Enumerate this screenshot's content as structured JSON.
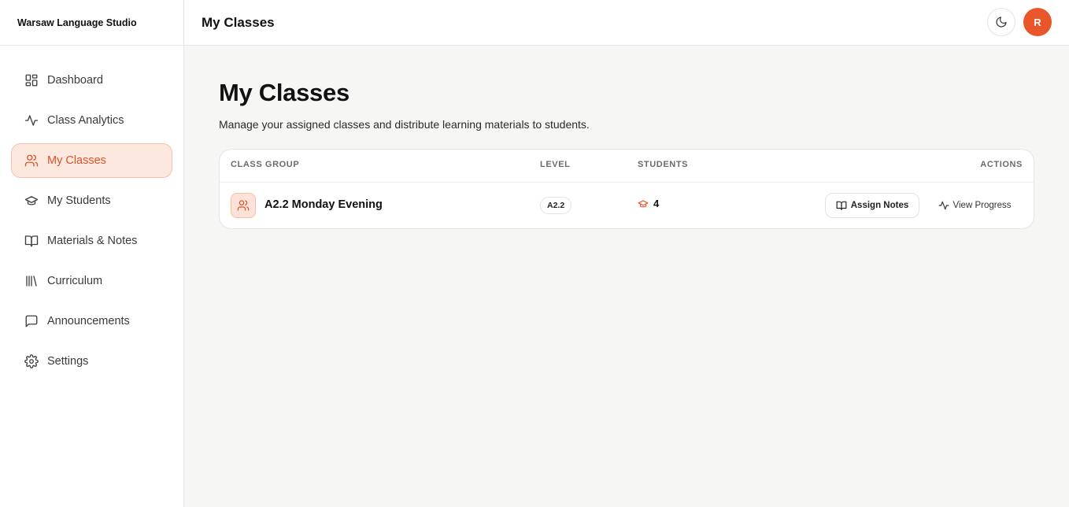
{
  "brand": {
    "name": "Warsaw Language Studio"
  },
  "sidebar": {
    "items": [
      {
        "label": "Dashboard",
        "icon": "dashboard-icon",
        "active": false
      },
      {
        "label": "Class Analytics",
        "icon": "activity-icon",
        "active": false
      },
      {
        "label": "My Classes",
        "icon": "users-icon",
        "active": true
      },
      {
        "label": "My Students",
        "icon": "graduation-cap-icon",
        "active": false
      },
      {
        "label": "Materials & Notes",
        "icon": "book-open-icon",
        "active": false
      },
      {
        "label": "Curriculum",
        "icon": "library-icon",
        "active": false
      },
      {
        "label": "Announcements",
        "icon": "message-square-icon",
        "active": false
      },
      {
        "label": "Settings",
        "icon": "gear-icon",
        "active": false
      }
    ]
  },
  "header": {
    "title": "My Classes",
    "theme_icon": "moon-icon",
    "avatar_initial": "R"
  },
  "main": {
    "title": "My Classes",
    "subtitle": "Manage your assigned classes and distribute learning materials to students.",
    "table": {
      "columns": [
        "CLASS GROUP",
        "LEVEL",
        "STUDENTS",
        "ACTIONS"
      ],
      "rows": [
        {
          "name": "A2.2 Monday Evening",
          "level": "A2.2",
          "students": "4",
          "assign_label": "Assign Notes",
          "view_label": "View Progress"
        }
      ]
    }
  },
  "colors": {
    "accent": "#e8562a",
    "active_bg": "#fde8df",
    "page_bg": "#f6f6f5"
  }
}
